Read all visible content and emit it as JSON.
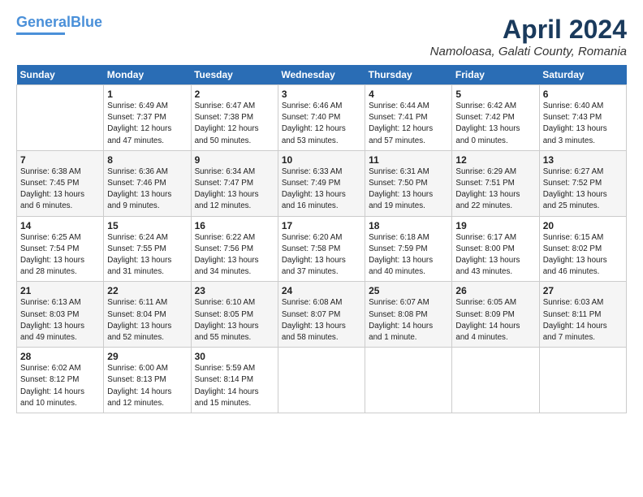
{
  "header": {
    "logo_line1": "General",
    "logo_line2": "Blue",
    "title": "April 2024",
    "subtitle": "Namoloasa, Galati County, Romania"
  },
  "days_of_week": [
    "Sunday",
    "Monday",
    "Tuesday",
    "Wednesday",
    "Thursday",
    "Friday",
    "Saturday"
  ],
  "weeks": [
    [
      {
        "day": "",
        "info": ""
      },
      {
        "day": "1",
        "info": "Sunrise: 6:49 AM\nSunset: 7:37 PM\nDaylight: 12 hours\nand 47 minutes."
      },
      {
        "day": "2",
        "info": "Sunrise: 6:47 AM\nSunset: 7:38 PM\nDaylight: 12 hours\nand 50 minutes."
      },
      {
        "day": "3",
        "info": "Sunrise: 6:46 AM\nSunset: 7:40 PM\nDaylight: 12 hours\nand 53 minutes."
      },
      {
        "day": "4",
        "info": "Sunrise: 6:44 AM\nSunset: 7:41 PM\nDaylight: 12 hours\nand 57 minutes."
      },
      {
        "day": "5",
        "info": "Sunrise: 6:42 AM\nSunset: 7:42 PM\nDaylight: 13 hours\nand 0 minutes."
      },
      {
        "day": "6",
        "info": "Sunrise: 6:40 AM\nSunset: 7:43 PM\nDaylight: 13 hours\nand 3 minutes."
      }
    ],
    [
      {
        "day": "7",
        "info": "Sunrise: 6:38 AM\nSunset: 7:45 PM\nDaylight: 13 hours\nand 6 minutes."
      },
      {
        "day": "8",
        "info": "Sunrise: 6:36 AM\nSunset: 7:46 PM\nDaylight: 13 hours\nand 9 minutes."
      },
      {
        "day": "9",
        "info": "Sunrise: 6:34 AM\nSunset: 7:47 PM\nDaylight: 13 hours\nand 12 minutes."
      },
      {
        "day": "10",
        "info": "Sunrise: 6:33 AM\nSunset: 7:49 PM\nDaylight: 13 hours\nand 16 minutes."
      },
      {
        "day": "11",
        "info": "Sunrise: 6:31 AM\nSunset: 7:50 PM\nDaylight: 13 hours\nand 19 minutes."
      },
      {
        "day": "12",
        "info": "Sunrise: 6:29 AM\nSunset: 7:51 PM\nDaylight: 13 hours\nand 22 minutes."
      },
      {
        "day": "13",
        "info": "Sunrise: 6:27 AM\nSunset: 7:52 PM\nDaylight: 13 hours\nand 25 minutes."
      }
    ],
    [
      {
        "day": "14",
        "info": "Sunrise: 6:25 AM\nSunset: 7:54 PM\nDaylight: 13 hours\nand 28 minutes."
      },
      {
        "day": "15",
        "info": "Sunrise: 6:24 AM\nSunset: 7:55 PM\nDaylight: 13 hours\nand 31 minutes."
      },
      {
        "day": "16",
        "info": "Sunrise: 6:22 AM\nSunset: 7:56 PM\nDaylight: 13 hours\nand 34 minutes."
      },
      {
        "day": "17",
        "info": "Sunrise: 6:20 AM\nSunset: 7:58 PM\nDaylight: 13 hours\nand 37 minutes."
      },
      {
        "day": "18",
        "info": "Sunrise: 6:18 AM\nSunset: 7:59 PM\nDaylight: 13 hours\nand 40 minutes."
      },
      {
        "day": "19",
        "info": "Sunrise: 6:17 AM\nSunset: 8:00 PM\nDaylight: 13 hours\nand 43 minutes."
      },
      {
        "day": "20",
        "info": "Sunrise: 6:15 AM\nSunset: 8:02 PM\nDaylight: 13 hours\nand 46 minutes."
      }
    ],
    [
      {
        "day": "21",
        "info": "Sunrise: 6:13 AM\nSunset: 8:03 PM\nDaylight: 13 hours\nand 49 minutes."
      },
      {
        "day": "22",
        "info": "Sunrise: 6:11 AM\nSunset: 8:04 PM\nDaylight: 13 hours\nand 52 minutes."
      },
      {
        "day": "23",
        "info": "Sunrise: 6:10 AM\nSunset: 8:05 PM\nDaylight: 13 hours\nand 55 minutes."
      },
      {
        "day": "24",
        "info": "Sunrise: 6:08 AM\nSunset: 8:07 PM\nDaylight: 13 hours\nand 58 minutes."
      },
      {
        "day": "25",
        "info": "Sunrise: 6:07 AM\nSunset: 8:08 PM\nDaylight: 14 hours\nand 1 minute."
      },
      {
        "day": "26",
        "info": "Sunrise: 6:05 AM\nSunset: 8:09 PM\nDaylight: 14 hours\nand 4 minutes."
      },
      {
        "day": "27",
        "info": "Sunrise: 6:03 AM\nSunset: 8:11 PM\nDaylight: 14 hours\nand 7 minutes."
      }
    ],
    [
      {
        "day": "28",
        "info": "Sunrise: 6:02 AM\nSunset: 8:12 PM\nDaylight: 14 hours\nand 10 minutes."
      },
      {
        "day": "29",
        "info": "Sunrise: 6:00 AM\nSunset: 8:13 PM\nDaylight: 14 hours\nand 12 minutes."
      },
      {
        "day": "30",
        "info": "Sunrise: 5:59 AM\nSunset: 8:14 PM\nDaylight: 14 hours\nand 15 minutes."
      },
      {
        "day": "",
        "info": ""
      },
      {
        "day": "",
        "info": ""
      },
      {
        "day": "",
        "info": ""
      },
      {
        "day": "",
        "info": ""
      }
    ]
  ]
}
